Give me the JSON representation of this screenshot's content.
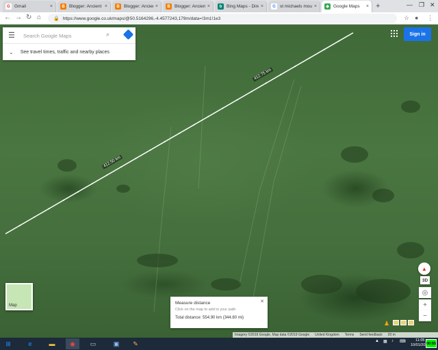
{
  "browser": {
    "tabs": [
      {
        "label": "Gmail",
        "favicon": "G",
        "color": "#ffffff",
        "fcolor": "#d93025"
      },
      {
        "label": "Blogger: Ancient",
        "favicon": "B",
        "color": "#f57c00"
      },
      {
        "label": "Blogger: Ancient",
        "favicon": "B",
        "color": "#f57c00"
      },
      {
        "label": "Blogger: Ancient",
        "favicon": "B",
        "color": "#f57c00"
      },
      {
        "label": "Bing Maps - Dire",
        "favicon": "b",
        "color": "#008373"
      },
      {
        "label": "st michaels mou",
        "favicon": "G",
        "color": "#ffffff",
        "fcolor": "#4285f4"
      },
      {
        "label": "Google Maps",
        "favicon": "◆",
        "color": "#34a853",
        "active": true
      }
    ],
    "url": "https://www.google.co.uk/maps/@50.5164296,-4.4577243,179m/data=!3m1!1e3"
  },
  "maps": {
    "search_placeholder": "Search Google Maps",
    "travel_prompt": "See travel times, traffic and nearby places",
    "sign_in": "Sign in",
    "layer_toggle": "Map",
    "view_3d": "3D",
    "distance_labels": [
      "412.50 km",
      "412.75 km"
    ],
    "measure": {
      "title": "Measure distance",
      "hint": "Click on the map to add to your path",
      "total": "Total distance: 554.90 km (344.80 mi)"
    },
    "attribution": [
      "Imagery ©2019 Google, Map data ©2019 Google",
      "United Kingdom",
      "Terms",
      "Send feedback",
      "20 m"
    ]
  },
  "taskbar": {
    "time": "11:05",
    "date": "10/01/2019",
    "overtime": "00:55"
  },
  "colors": {
    "accent": "#1a73e8",
    "terrain": "#4a7641"
  }
}
